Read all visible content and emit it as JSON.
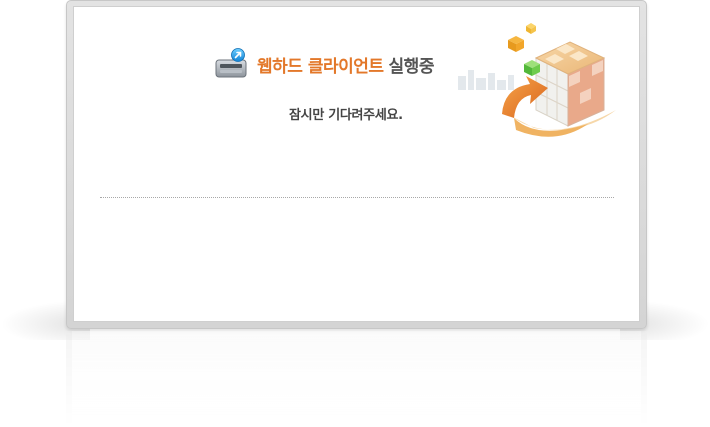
{
  "dialog": {
    "title_highlight": "웹하드 클라이언트",
    "title_rest": "실행중",
    "message": "잠시만 기다려주세요."
  },
  "icons": {
    "app": "hard-drive-icon",
    "illustration": "cube-puzzle-illustration"
  },
  "colors": {
    "accent": "#e3782a",
    "text": "#555555"
  }
}
